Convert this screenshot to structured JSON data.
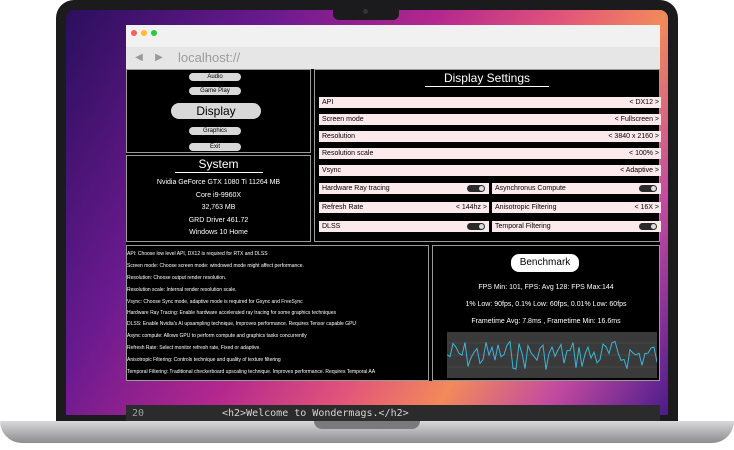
{
  "browser": {
    "url": "localhost://"
  },
  "menu": {
    "items": [
      "Audio",
      "Game Play",
      "Display",
      "Graphics",
      "Exit"
    ]
  },
  "system": {
    "title": "System",
    "lines": [
      "Nvidia GeForce GTX 1080 Ti 11264 MB",
      "Core i9-9960X",
      "32,763 MB",
      "GRD Driver 461.72",
      "Windows 10 Home"
    ]
  },
  "display": {
    "title": "Display Settings",
    "rows": [
      {
        "label": "API",
        "value": "< DX12 >"
      },
      {
        "label": "Screen mode",
        "value": "< Fullscreen >"
      },
      {
        "label": "Resolution",
        "value": "< 3840 x 2160 >"
      },
      {
        "label": "Resolution scale",
        "value": "< 100% >"
      },
      {
        "label": "Vsync",
        "value": "< Adaptive >"
      }
    ],
    "pairs": [
      {
        "left": "Hardware Ray tracing",
        "right": "Asynchronus Compute",
        "right_value": ""
      },
      {
        "left": "Refresh Rate",
        "left_value": "< 144hz >",
        "right": "Anisotropic Filtering",
        "right_value": "< 16X >"
      },
      {
        "left": "DLSS",
        "right": "Temporal Filtering",
        "right_value": ""
      }
    ]
  },
  "help": [
    "API: Choose low level API, DX12 is required for RTX and DLSS",
    "Screen mode: Choose screen mode: windowed mode might affect performance.",
    "Resolution: Choose output render resolution.",
    "Resolution scale:  Internal render resolution scale.",
    "Vsync: Choose Sync mode, adaptive mode is required for Gsync and FreeSync",
    "Hardware Ray Tracing: Enable hardware accelerated ray tracing for some graphics techniques",
    "DLSS: Enable Nvidia's AI upsampling technique, Improves performance. Requires Tensor capable GPU",
    "Async compute: Allows GPU to perform compute and graphics tasks concurrently",
    "Refresh Rate: Select monitor refresh rate, Fixed or adaptive.",
    "Anisotropic Filtering: Controls technique and quality of texture filtering",
    "Temporal Filtering: Traditional checkerboard upscaling technique. Improves performance. Requires Temporal AA"
  ],
  "benchmark": {
    "button": "Benchmark",
    "fps": "FPS Min: 101, FPS: Avg 128: FPS Max:144",
    "lows": "1% Low: 90fps, 0.1% Low: 60fps,  0.01% Low: 60fps",
    "frametime": "Frametime Avg: 7.8ms , Frametime Min: 16.6ms",
    "color": "#3fb4d6"
  },
  "code": {
    "line_no": "20",
    "text": "<h2>Welcome to Wondermags.</h2>"
  }
}
